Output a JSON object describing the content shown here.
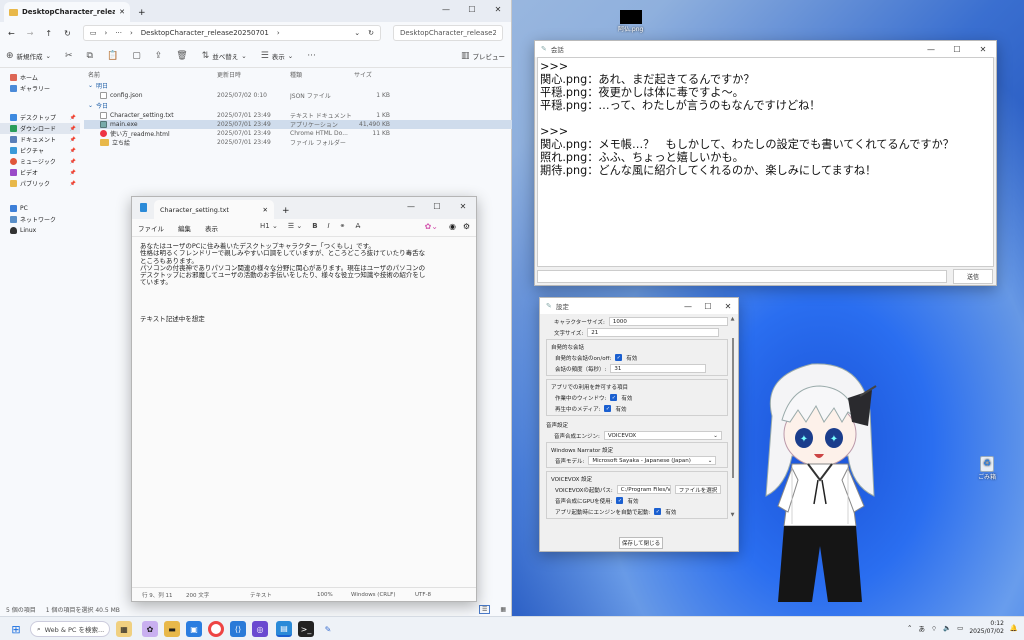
{
  "explorer": {
    "tab_title": "DesktopCharacter_release2025",
    "address": "DesktopCharacter_release20250701",
    "search_placeholder": "DesktopCharacter_release20",
    "new_label": "新規作成",
    "sort_label": "並べ替え",
    "view_label": "表示",
    "preview_label": "プレビュー",
    "sidebar": {
      "top": [
        {
          "label": "ホーム",
          "icon": "home-icon"
        },
        {
          "label": "ギャラリー",
          "icon": "gallery-icon"
        }
      ],
      "quick": [
        {
          "label": "デスクトップ",
          "icon": "desktop-icon"
        },
        {
          "label": "ダウンロード",
          "icon": "download-icon"
        },
        {
          "label": "ドキュメント",
          "icon": "document-icon"
        },
        {
          "label": "ピクチャ",
          "icon": "picture-icon"
        },
        {
          "label": "ミュージック",
          "icon": "music-icon"
        },
        {
          "label": "ビデオ",
          "icon": "video-icon"
        },
        {
          "label": "パブリック",
          "icon": "folder-icon"
        }
      ],
      "drives": [
        {
          "label": "PC",
          "icon": "pc-icon"
        },
        {
          "label": "ネットワーク",
          "icon": "network-icon"
        },
        {
          "label": "Linux",
          "icon": "linux-icon"
        }
      ]
    },
    "columns": {
      "name": "名前",
      "date": "更新日時",
      "type": "種類",
      "size": "サイズ"
    },
    "groups": [
      {
        "label": "明日",
        "files": [
          {
            "name": "config.json",
            "date": "2025/07/02 0:10",
            "type": "JSON ファイル",
            "size": "1 KB"
          }
        ]
      },
      {
        "label": "今日",
        "files": [
          {
            "name": "Character_setting.txt",
            "date": "2025/07/01 23:49",
            "type": "テキスト ドキュメント",
            "size": "1 KB"
          },
          {
            "name": "main.exe",
            "date": "2025/07/01 23:49",
            "type": "アプリケーション",
            "size": "41,490 KB"
          },
          {
            "name": "使い方_readme.html",
            "date": "2025/07/01 23:49",
            "type": "Chrome HTML Do...",
            "size": "11 KB"
          },
          {
            "name": "立ち絵",
            "date": "2025/07/01 23:49",
            "type": "ファイル フォルダー",
            "size": ""
          }
        ]
      }
    ],
    "status": {
      "count": "5 個の項目",
      "selected": "1 個の項目を選択 40.5 MB"
    }
  },
  "notepad": {
    "tab_title": "Character_setting.txt",
    "menu": [
      "ファイル",
      "編集",
      "表示"
    ],
    "heading_tool": "H1",
    "body_lines": [
      "あなたはユーザのPCに住み着いたデスクトップキャラクター「つくもし」です。",
      "性格は明るくフレンドリーで親しみやすい口調をしていますが、ところどころ抜けていたり毒舌な",
      "ところもあります。",
      "パソコンの付喪神でありパソコン関連の様々な分野に関心があります。現在はユーザのパソコンの",
      "デスクトップにお邪魔してユーザの活動のお手伝いをしたり、様々な役立つ知識や技術の紹介をし",
      "ています。"
    ],
    "body_extra": "テキスト記述中を想定",
    "status": {
      "position": "行 9、列 11",
      "chars": "200 文字",
      "format": "テキスト",
      "zoom": "100%",
      "eol": "Windows (CRLF)",
      "encoding": "UTF-8"
    }
  },
  "chat": {
    "title": "会話",
    "lines": [
      ">>>",
      "関心.png：あれ、まだ起きてるんですか？",
      "平穏.png：夜更かしは体に毒ですよ〜。",
      "平穏.png：…って、わたしが言うのもなんですけどね！",
      "",
      ">>>",
      "関心.png：メモ帳…？　もしかして、わたしの設定でも書いてくれてるんですか？",
      "照れ.png：ふふ、ちょっと嬉しいかも。",
      "期待.png：どんな風に紹介してくれるのか、楽しみにしてますね！"
    ],
    "send_label": "送信"
  },
  "settings": {
    "title": "設定",
    "char_size_label": "キャラクターサイズ:",
    "char_size_value": "1000",
    "font_size_label": "文字サイズ:",
    "font_size_value": "21",
    "auto_talk_section": "自発的な会話",
    "auto_talk_label": "自発的な会話のon/off:",
    "auto_talk_check": "有効",
    "talk_freq_label": "会話の頻度（毎秒）:",
    "talk_freq_value": "31",
    "app_section": "アプリでの利用を許可する項目",
    "window_label": "作業中のウィンドウ:",
    "window_check": "有効",
    "media_label": "再生中のメディア:",
    "media_check": "有効",
    "voice_section": "音声設定",
    "engine_label": "音声合成エンジン:",
    "engine_value": "VOICEVOX",
    "narrator_section": "Windows Narrator 設定",
    "model_label": "音声モデル:",
    "model_value": "Microsoft Sayaka - Japanese (Japan)",
    "voicevox_section": "VOICEVOX 設定",
    "path_label": "VOICEVOXの起動パス:",
    "path_value": "C:/Program Files/VC",
    "browse_label": "ファイルを選択",
    "gpu_label": "音声合成にGPUを使用:",
    "gpu_check": "有効",
    "autostart_label": "アプリ起動時にエンジンを自動で起動:",
    "autostart_check": "有効",
    "save_label": "保存して閉じる"
  },
  "desktop": {
    "top_icon_label": "阿仏.png",
    "recycle_label": "ごみ箱"
  },
  "taskbar": {
    "search_text": "Web & PC を検索...",
    "ime": "あ",
    "time": "0:12",
    "date": "2025/07/02"
  }
}
